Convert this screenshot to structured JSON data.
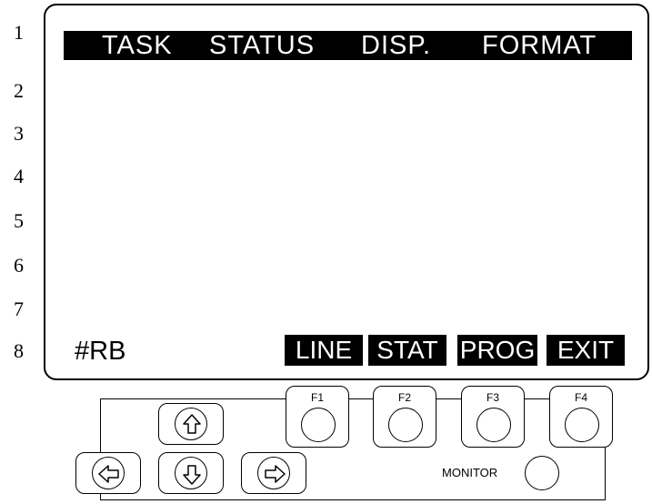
{
  "line_numbers": [
    "1",
    "2",
    "3",
    "4",
    "5",
    "6",
    "7",
    "8"
  ],
  "screen": {
    "title_items": [
      "TASK",
      "STATUS",
      "DISP.",
      "FORMAT"
    ],
    "mode_label": "#RB",
    "function_keys": [
      "LINE",
      "STAT",
      "PROG",
      "EXIT"
    ]
  },
  "keypad": {
    "f_buttons": [
      "F1",
      "F2",
      "F3",
      "F4"
    ],
    "arrows": {
      "up": "up-arrow-icon",
      "down": "down-arrow-icon",
      "left": "left-arrow-icon",
      "right": "right-arrow-icon"
    },
    "monitor_label": "MONITOR"
  }
}
